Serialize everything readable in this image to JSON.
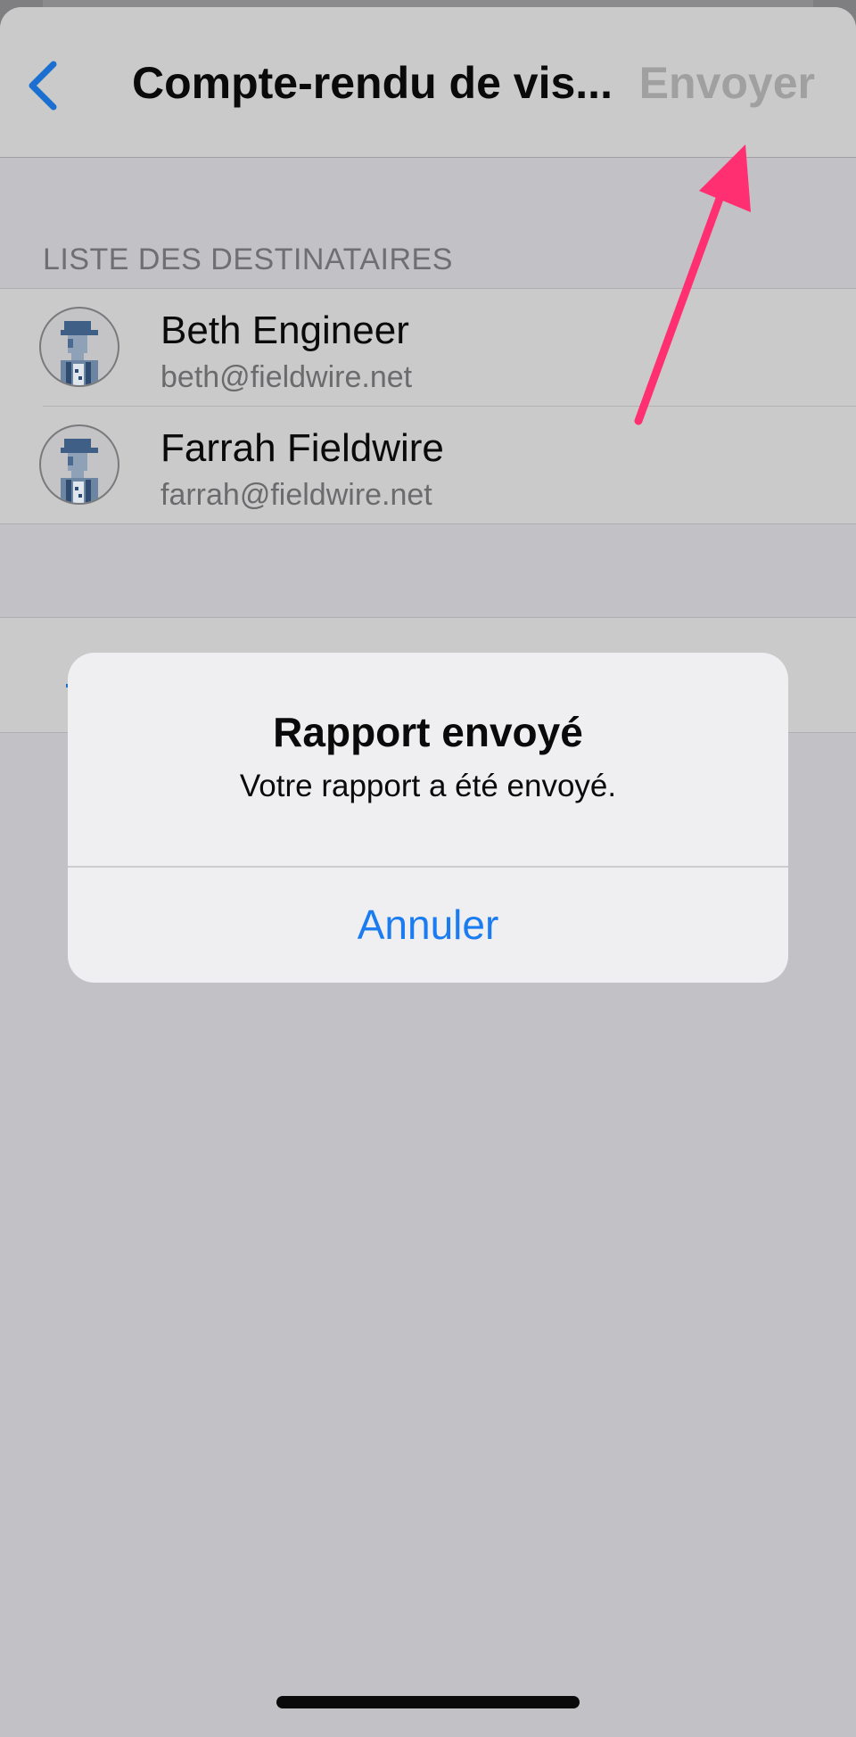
{
  "nav": {
    "title": "Compte-rendu de vis...",
    "send_label": "Envoyer",
    "back_icon": "chevron-left-icon",
    "accent_color": "#1a6fd0",
    "disabled_color": "#a0a0a0"
  },
  "recipients": {
    "header": "LISTE DES DESTINATAIRES",
    "items": [
      {
        "name": "Beth Engineer",
        "email": "beth@fieldwire.net",
        "avatar_icon": "worker-avatar-icon"
      },
      {
        "name": "Farrah Fieldwire",
        "email": "farrah@fieldwire.net",
        "avatar_icon": "worker-avatar-icon"
      }
    ]
  },
  "annotation": {
    "arrow_icon": "pointer-arrow-icon",
    "color": "#ff2f72"
  },
  "alert": {
    "title": "Rapport envoyé",
    "message": "Votre rapport a été envoyé.",
    "button_label": "Annuler",
    "button_color": "#1a7cf0"
  }
}
